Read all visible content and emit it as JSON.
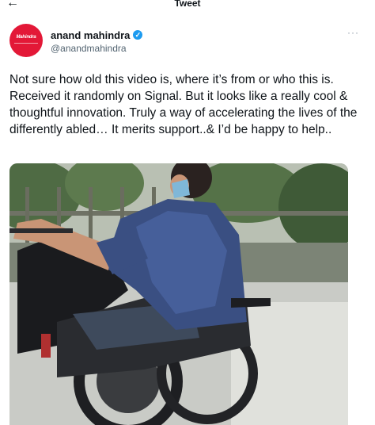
{
  "topbar": {
    "title": "Tweet",
    "back_icon": "arrow-left-icon"
  },
  "author": {
    "avatar_text": "Mahindra",
    "display_name": "anand mahindra",
    "handle": "@anandmahindra",
    "verified_icon": "verified-badge-icon",
    "more_icon": "more-horizontal-icon"
  },
  "tweet": {
    "text": "Not sure how old this video is, where it’s from or who this is. Received it randomly on Signal. But it looks like a really cool & thoughtful innovation. Truly a way of accelerating the lives of the differently abled… It merits support..& I’d be happy to help.."
  },
  "media": {
    "kind": "video-still"
  },
  "colors": {
    "brand_red": "#e31837",
    "verified_blue": "#1d9bf0",
    "text": "#0f1419",
    "muted": "#536471"
  }
}
